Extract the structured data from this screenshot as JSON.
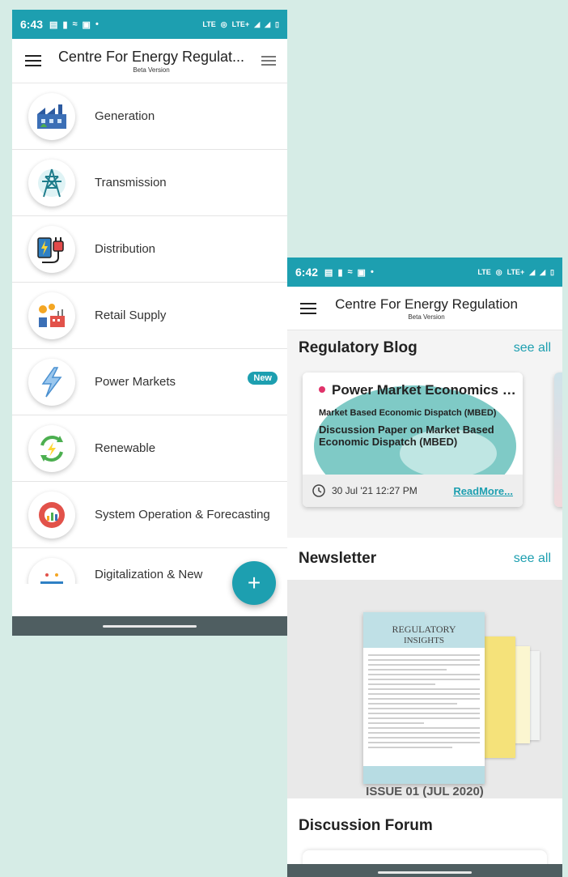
{
  "phone1": {
    "status": {
      "time": "6:43",
      "network": "LTE",
      "network_plus": "LTE+"
    },
    "appbar": {
      "title": "Centre For Energy Regulat...",
      "subtitle": "Beta Version"
    },
    "categories": [
      {
        "label": "Generation",
        "icon": "factory-icon"
      },
      {
        "label": "Transmission",
        "icon": "transmission-tower-icon"
      },
      {
        "label": "Distribution",
        "icon": "plug-icon"
      },
      {
        "label": "Retail Supply",
        "icon": "retail-supply-icon"
      },
      {
        "label": "Power Markets",
        "icon": "lightning-icon",
        "badge": "New"
      },
      {
        "label": "Renewable",
        "icon": "renewable-icon"
      },
      {
        "label": "System Operation & Forecasting",
        "icon": "gear-chart-icon"
      },
      {
        "label": "Digitalization & New",
        "icon": "digital-icon"
      }
    ],
    "fab": "+"
  },
  "phone2": {
    "status": {
      "time": "6:42",
      "network": "LTE",
      "network_plus": "LTE+"
    },
    "appbar": {
      "title": "Centre For Energy Regulation",
      "subtitle": "Beta Version"
    },
    "blog": {
      "title": "Regulatory Blog",
      "see_all": "see all",
      "card": {
        "headline": "Power Market Economics a...",
        "sub1": "Market Based Economic Dispatch (MBED)",
        "sub2": "Discussion Paper on Market Based Economic Dispatch (MBED)",
        "date": "30 Jul '21 12:27 PM",
        "read_more": "ReadMore..."
      }
    },
    "newsletter": {
      "title": "Newsletter",
      "see_all": "see all",
      "cover_title_1": "REGULATORY",
      "cover_title_2": "INSIGHTS",
      "caption": "ISSUE 01 (JUL 2020)"
    },
    "forum": {
      "title": "Discussion Forum"
    }
  },
  "colors": {
    "accent": "#1d9fb0",
    "status_bar": "#1d9fb0",
    "nav_bar": "#4f5e61",
    "badge": "#1d9fb0",
    "dot": "#e0336a"
  }
}
